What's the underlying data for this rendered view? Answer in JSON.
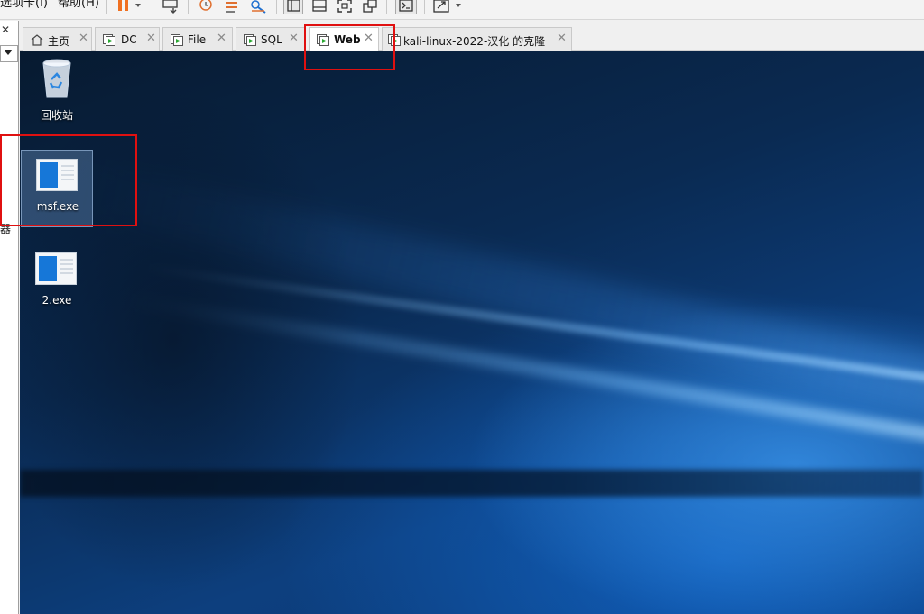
{
  "menu": {
    "tabs_menu": "选项卡(I)",
    "help_menu": "帮助(H)"
  },
  "library": {
    "close_glyph": "✕",
    "side_text": "器"
  },
  "tabs": [
    {
      "label": "主页",
      "icon": "home-icon",
      "active": false
    },
    {
      "label": "DC",
      "icon": "vm-icon",
      "active": false
    },
    {
      "label": "File",
      "icon": "vm-icon",
      "active": false
    },
    {
      "label": "SQL",
      "icon": "vm-icon",
      "active": false
    },
    {
      "label": "Web",
      "icon": "vm-icon",
      "active": true
    },
    {
      "label": "kali-linux-2022-汉化 的克隆",
      "icon": "vm-icon",
      "active": false
    }
  ],
  "tab_close_glyph": "✕",
  "desktop": {
    "icons": [
      {
        "label": "回收站",
        "icon": "recycle-bin-icon",
        "selected": false
      },
      {
        "label": "msf.exe",
        "icon": "exe-file-icon",
        "selected": true
      },
      {
        "label": "2.exe",
        "icon": "exe-file-icon",
        "selected": false
      }
    ]
  },
  "colors": {
    "highlight_box": "#e01010",
    "desktop_blue": "#0d3f7e",
    "pause_orange": "#f07020"
  }
}
